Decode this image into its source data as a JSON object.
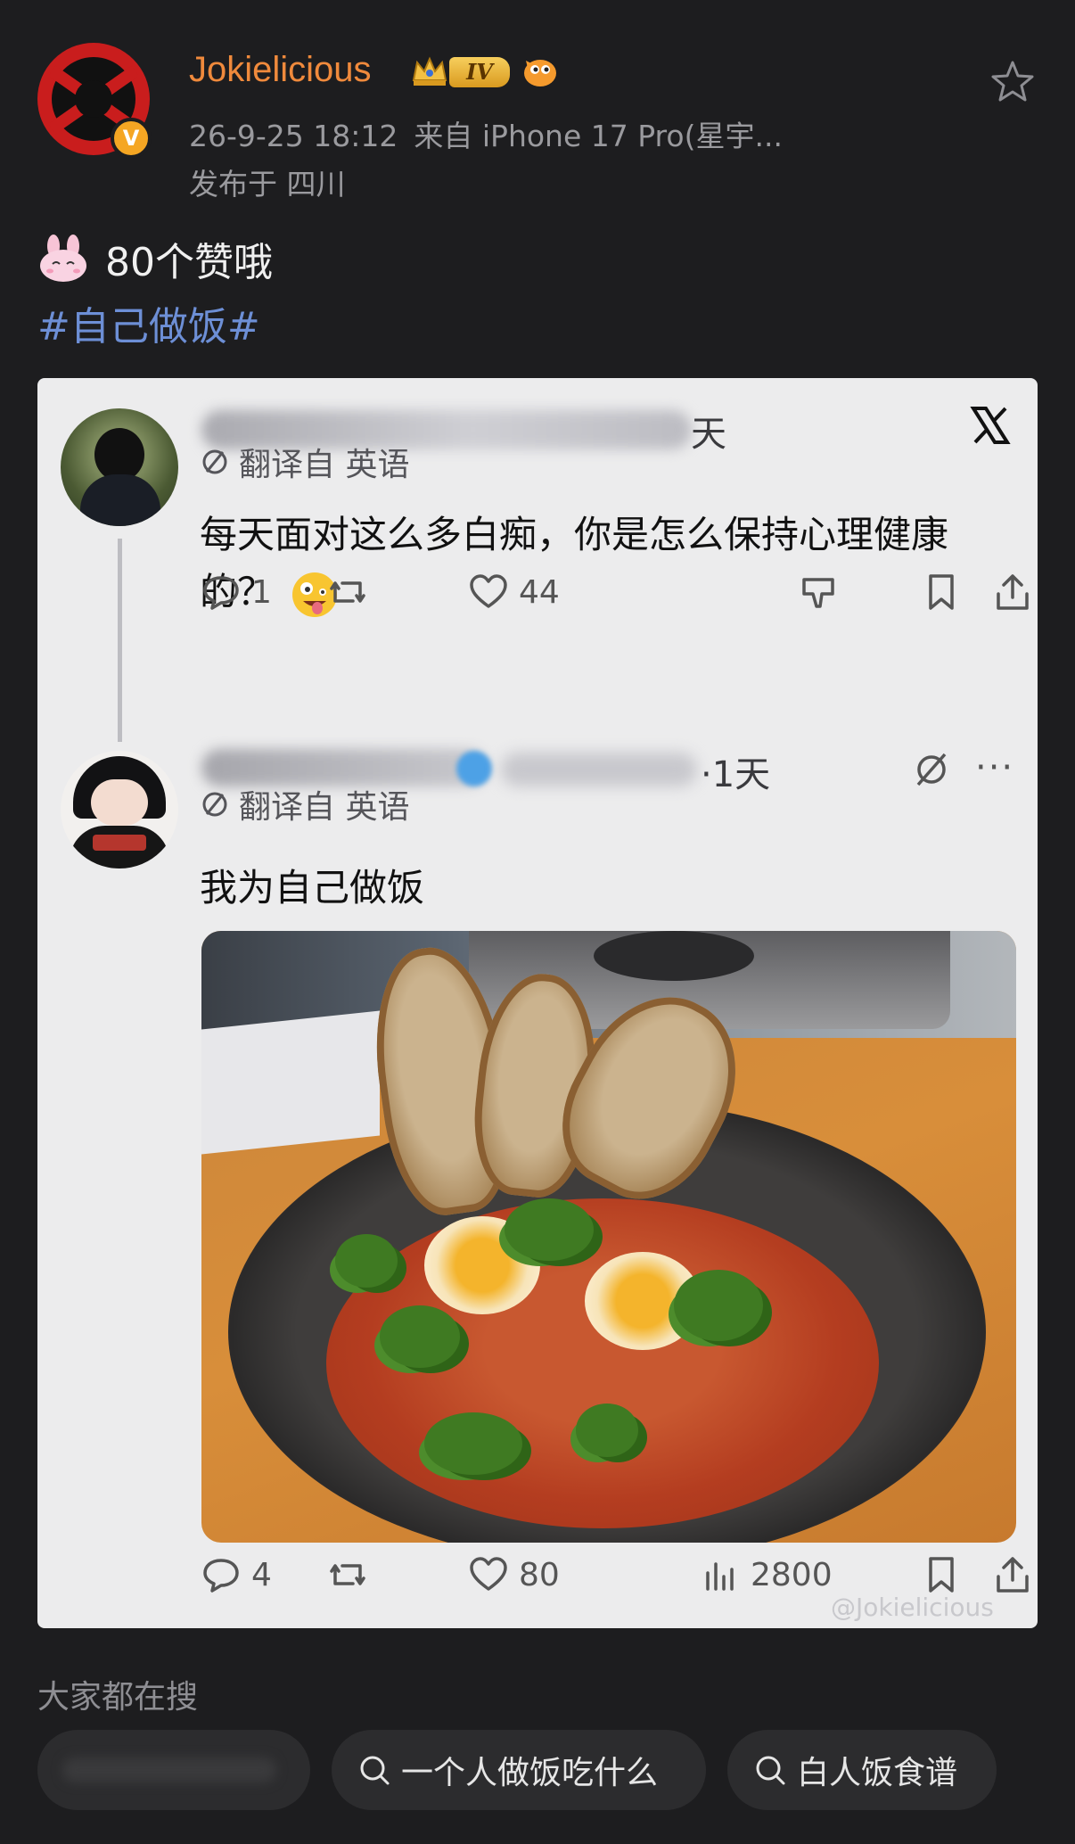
{
  "post": {
    "username": "Jokielicious",
    "level_badge": "IV",
    "timestamp": "26-9-25 18:12",
    "source": "来自 iPhone 17 Pro(星宇...",
    "location": "发布于 四川",
    "text": "80个赞哦",
    "hashtag": "#自己做饭#"
  },
  "embedded": {
    "tweet1": {
      "time_ago": "天",
      "translate_label": "翻译自 英语",
      "text": "每天面对这么多白痴，你是怎么保持心理健康的？",
      "reply_count": "1",
      "like_count": "44"
    },
    "tweet2": {
      "time_ago": "·1天",
      "more": "···",
      "translate_label": "翻译自 英语",
      "text": "我为自己做饭",
      "reply_count": "4",
      "like_count": "80",
      "view_count": "2800"
    },
    "watermark": "@Jokielicious"
  },
  "search": {
    "title": "大家都在搜",
    "pills": [
      "",
      "一个人做饭吃什么",
      "白人饭食谱"
    ]
  },
  "colors": {
    "username": "#f08a3c",
    "hashtag": "#6d8fd6",
    "background": "#1d1d1f",
    "card": "#ececed"
  }
}
